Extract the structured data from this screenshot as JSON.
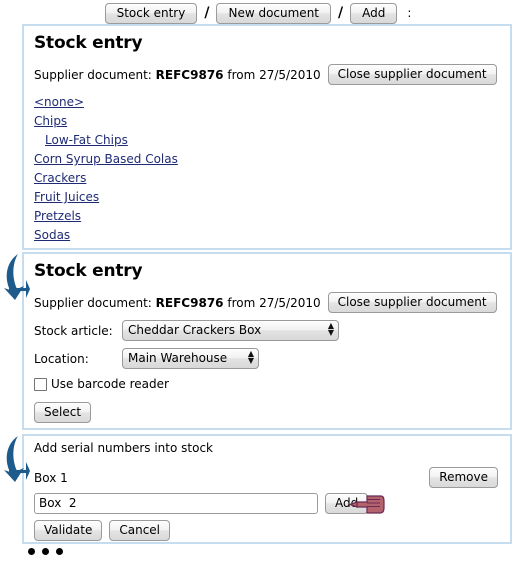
{
  "breadcrumb": {
    "items": [
      {
        "label": "Stock entry"
      },
      {
        "label": "New document"
      },
      {
        "label": "Add"
      }
    ],
    "separator": "/",
    "trailing": ":"
  },
  "panel1": {
    "title": "Stock entry",
    "supplier_label": "Supplier document:",
    "supplier_ref": "REFC9876",
    "supplier_from": "from 27/5/2010",
    "close_button": "Close supplier document",
    "categories": [
      {
        "label": "<none>",
        "indent": false
      },
      {
        "label": "Chips",
        "indent": false
      },
      {
        "label": "Low-Fat Chips",
        "indent": true
      },
      {
        "label": "Corn Syrup Based Colas",
        "indent": false
      },
      {
        "label": "Crackers",
        "indent": false
      },
      {
        "label": "Fruit Juices",
        "indent": false
      },
      {
        "label": "Pretzels",
        "indent": false
      },
      {
        "label": "Sodas",
        "indent": false
      }
    ]
  },
  "panel2": {
    "title": "Stock entry",
    "supplier_label": "Supplier document:",
    "supplier_ref": "REFC9876",
    "supplier_from": "from 27/5/2010",
    "close_button": "Close supplier document",
    "stock_article_label": "Stock article:",
    "stock_article_value": "Cheddar Crackers Box",
    "location_label": "Location:",
    "location_value": "Main Warehouse",
    "barcode_label": "Use barcode reader",
    "barcode_checked": false,
    "select_button": "Select"
  },
  "panel3": {
    "title": "Add serial numbers into stock",
    "existing_serial": "Box 1",
    "remove_button": "Remove",
    "input_value": "Box  2",
    "add_button": "Add",
    "validate_button": "Validate",
    "cancel_button": "Cancel"
  },
  "annotations": {
    "arrow_color": "#1c5b8c",
    "hand_color": "#b4636e",
    "ellipsis_dots": 3
  },
  "colors": {
    "panel_border": "#c6ddf0",
    "link": "#1f2b75",
    "button_face": "#e9e9e9"
  }
}
